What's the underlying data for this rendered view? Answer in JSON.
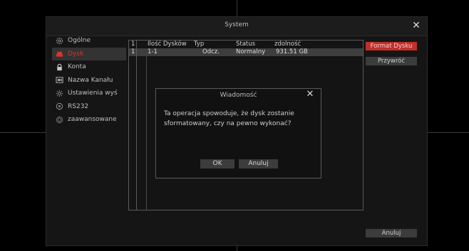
{
  "window": {
    "title": "System",
    "close_glyph": "✕"
  },
  "sidebar": {
    "items": [
      {
        "label": "Ogólne",
        "icon": "gear-icon",
        "active": false
      },
      {
        "label": "Dysk",
        "icon": "hdd-icon",
        "active": true
      },
      {
        "label": "Konta",
        "icon": "lock-icon",
        "active": false
      },
      {
        "label": "Nazwa Kanału",
        "icon": "camera-icon",
        "active": false
      },
      {
        "label": "Ustawienia wyś",
        "icon": "sun-icon",
        "active": false
      },
      {
        "label": "RS232",
        "icon": "port-icon",
        "active": false
      },
      {
        "label": "zaawansowane",
        "icon": "advanced-icon",
        "active": false
      }
    ]
  },
  "table": {
    "headers": {
      "num": "1",
      "count": "Ilość Dysków",
      "type": "Typ",
      "status": "Status",
      "capacity": "zdolność"
    },
    "rows": [
      {
        "num": "1",
        "count": "1-1",
        "type": "Odcz.",
        "status": "Normalny",
        "capacity": "931.51 GB"
      }
    ]
  },
  "buttons": {
    "format": "Format Dysku",
    "restore": "Przywróć",
    "cancel": "Anuluj"
  },
  "dialog": {
    "title": "Wiadomość",
    "close_glyph": "✕",
    "line1": "Ta operacja spowoduje, że dysk zostanie",
    "line2": "sformatowany, czy na pewno wykonać?",
    "ok": "OK",
    "cancel": "Anuluj"
  },
  "colors": {
    "accent": "#c0302a",
    "active_text": "#d9342b",
    "background": "#151515"
  }
}
